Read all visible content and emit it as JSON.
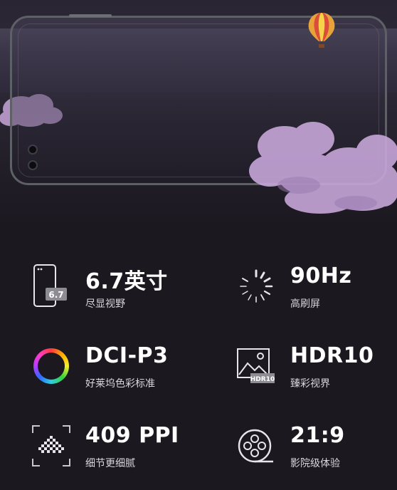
{
  "features": [
    {
      "id": "size",
      "title": "6.7英寸",
      "subtitle": "尽显视野",
      "icon": "phone-size-icon",
      "badge": "6.7"
    },
    {
      "id": "refresh",
      "title": "90Hz",
      "subtitle": "高刷屏",
      "icon": "refresh-rate-icon"
    },
    {
      "id": "color",
      "title": "DCI-P3",
      "subtitle": "好莱坞色彩标准",
      "icon": "color-wheel-icon"
    },
    {
      "id": "hdr",
      "title": "HDR10",
      "subtitle": "臻彩视界",
      "icon": "hdr-image-icon",
      "badge": "HDR10"
    },
    {
      "id": "ppi",
      "title": "409 PPI",
      "subtitle": "细节更细腻",
      "icon": "pixel-density-icon"
    },
    {
      "id": "ratio",
      "title": "21:9",
      "subtitle": "影院级体验",
      "icon": "film-reel-icon"
    }
  ]
}
